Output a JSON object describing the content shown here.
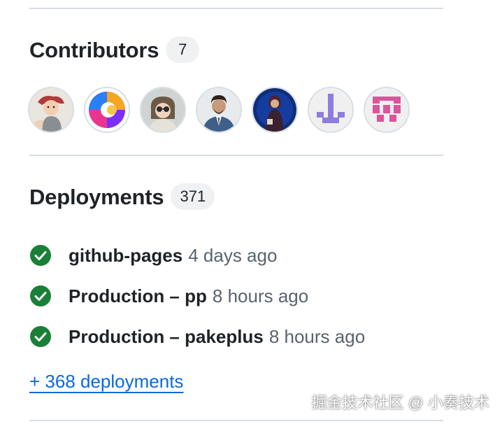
{
  "contributors": {
    "title": "Contributors",
    "count": "7",
    "avatars": [
      {
        "icon": "baby-photo-avatar"
      },
      {
        "icon": "colorful-logo-avatar"
      },
      {
        "icon": "girl-sunglasses-avatar"
      },
      {
        "icon": "man-suit-avatar"
      },
      {
        "icon": "person-blue-avatar"
      },
      {
        "icon": "purple-identicon-avatar"
      },
      {
        "icon": "pink-identicon-avatar"
      }
    ]
  },
  "deployments": {
    "title": "Deployments",
    "count": "371",
    "items": [
      {
        "name": "github-pages",
        "time": "4 days ago",
        "status": "success"
      },
      {
        "name": "Production – pp",
        "time": "8 hours ago",
        "status": "success"
      },
      {
        "name": "Production – pakeplus",
        "time": "8 hours ago",
        "status": "success"
      }
    ],
    "more_link": "+ 368 deployments"
  },
  "watermark": "掘金技术社区 @ 小奏技术",
  "colors": {
    "success": "#1a7f37",
    "link": "#0969da",
    "text": "#1f2328",
    "muted": "#59636e",
    "divider": "#d8dee4",
    "badge_bg": "#eff1f3"
  }
}
